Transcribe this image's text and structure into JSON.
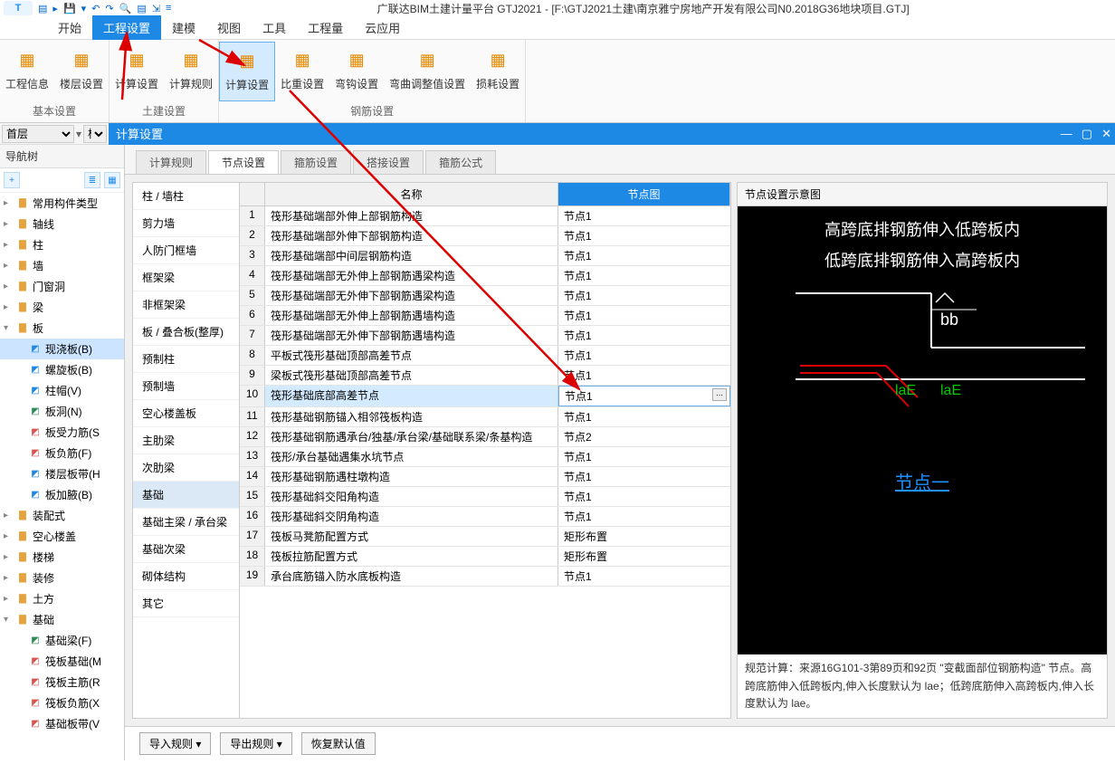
{
  "title": "广联达BIM土建计量平台 GTJ2021 - [F:\\GTJ2021土建\\南京雅宁房地产开发有限公司N0.2018G36地块项目.GTJ]",
  "logo": "T",
  "menubar": {
    "items": [
      "开始",
      "工程设置",
      "建模",
      "视图",
      "工具",
      "工程量",
      "云应用"
    ],
    "active": 1
  },
  "ribbon": {
    "groups": [
      {
        "label": "基本设置",
        "buttons": [
          {
            "label": "工程信息"
          },
          {
            "label": "楼层设置"
          }
        ]
      },
      {
        "label": "土建设置",
        "buttons": [
          {
            "label": "计算设置"
          },
          {
            "label": "计算规则"
          }
        ]
      },
      {
        "label": "钢筋设置",
        "buttons": [
          {
            "label": "计算设置",
            "active": true
          },
          {
            "label": "比重设置"
          },
          {
            "label": "弯钩设置"
          },
          {
            "label": "弯曲调整值设置"
          },
          {
            "label": "损耗设置"
          }
        ]
      }
    ]
  },
  "subbar": {
    "sel1": "首层",
    "sel2": "板",
    "calc_header": "计算设置"
  },
  "nav": {
    "title": "导航树",
    "tree": [
      {
        "label": "常用构件类型",
        "root": true
      },
      {
        "label": "轴线",
        "root": true
      },
      {
        "label": "柱",
        "root": true
      },
      {
        "label": "墙",
        "root": true
      },
      {
        "label": "门窗洞",
        "root": true
      },
      {
        "label": "梁",
        "root": true
      },
      {
        "label": "板",
        "root": true,
        "expanded": true,
        "children": [
          {
            "label": "现浇板(B)",
            "icon": "blue",
            "selected": true
          },
          {
            "label": "螺旋板(B)",
            "icon": "blue"
          },
          {
            "label": "柱帽(V)",
            "icon": "blue"
          },
          {
            "label": "板洞(N)",
            "icon": "green"
          },
          {
            "label": "板受力筋(S",
            "icon": "red"
          },
          {
            "label": "板负筋(F)",
            "icon": "red"
          },
          {
            "label": "楼层板带(H",
            "icon": "blue"
          },
          {
            "label": "板加腋(B)",
            "icon": "blue"
          }
        ]
      },
      {
        "label": "装配式",
        "root": true
      },
      {
        "label": "空心楼盖",
        "root": true
      },
      {
        "label": "楼梯",
        "root": true
      },
      {
        "label": "装修",
        "root": true
      },
      {
        "label": "土方",
        "root": true
      },
      {
        "label": "基础",
        "root": true,
        "expanded": true,
        "children": [
          {
            "label": "基础梁(F)",
            "icon": "green"
          },
          {
            "label": "筏板基础(M",
            "icon": "red"
          },
          {
            "label": "筏板主筋(R",
            "icon": "red"
          },
          {
            "label": "筏板负筋(X",
            "icon": "red"
          },
          {
            "label": "基础板带(V",
            "icon": "red"
          }
        ]
      }
    ]
  },
  "tabs": {
    "items": [
      "计算规则",
      "节点设置",
      "箍筋设置",
      "搭接设置",
      "箍筋公式"
    ],
    "active": 1
  },
  "categories": {
    "items": [
      "柱 / 墙柱",
      "剪力墙",
      "人防门框墙",
      "框架梁",
      "非框架梁",
      "板 / 叠合板(整厚)",
      "预制柱",
      "预制墙",
      "空心楼盖板",
      "主肋梁",
      "次肋梁",
      "基础",
      "基础主梁 / 承台梁",
      "基础次梁",
      "砌体结构",
      "其它"
    ],
    "active": 11
  },
  "table": {
    "head_name": "名称",
    "head_node": "节点图",
    "rows": [
      {
        "name": "筏形基础端部外伸上部钢筋构造",
        "node": "节点1"
      },
      {
        "name": "筏形基础端部外伸下部钢筋构造",
        "node": "节点1"
      },
      {
        "name": "筏形基础端部中间层钢筋构造",
        "node": "节点1"
      },
      {
        "name": "筏形基础端部无外伸上部钢筋遇梁构造",
        "node": "节点1"
      },
      {
        "name": "筏形基础端部无外伸下部钢筋遇梁构造",
        "node": "节点1"
      },
      {
        "name": "筏形基础端部无外伸上部钢筋遇墙构造",
        "node": "节点1"
      },
      {
        "name": "筏形基础端部无外伸下部钢筋遇墙构造",
        "node": "节点1"
      },
      {
        "name": "平板式筏形基础顶部高差节点",
        "node": "节点1"
      },
      {
        "name": "梁板式筏形基础顶部高差节点",
        "node": "节点1"
      },
      {
        "name": "筏形基础底部高差节点",
        "node": "节点1",
        "selected": true
      },
      {
        "name": "筏形基础钢筋锚入相邻筏板构造",
        "node": "节点1"
      },
      {
        "name": "筏形基础钢筋遇承台/独基/承台梁/基础联系梁/条基构造",
        "node": "节点2"
      },
      {
        "name": "筏形/承台基础遇集水坑节点",
        "node": "节点1"
      },
      {
        "name": "筏形基础钢筋遇柱墩构造",
        "node": "节点1"
      },
      {
        "name": "筏形基础斜交阳角构造",
        "node": "节点1"
      },
      {
        "name": "筏形基础斜交阴角构造",
        "node": "节点1"
      },
      {
        "name": "筏板马凳筋配置方式",
        "node": "矩形布置"
      },
      {
        "name": "筏板拉筋配置方式",
        "node": "矩形布置"
      },
      {
        "name": "承台底筋锚入防水底板构造",
        "node": "节点1"
      }
    ]
  },
  "diagram": {
    "title": "节点设置示意图",
    "line1": "高跨底排钢筋伸入低跨板内",
    "line2": "低跨底排钢筋伸入高跨板内",
    "lbl_bb": "bb",
    "lbl_lae1": "laE",
    "lbl_lae2": "laE",
    "link": "节点一",
    "note": "规范计算：来源16G101-3第89页和92页 \"变截面部位钢筋构造\" 节点。高跨底筋伸入低跨板内,伸入长度默认为 lae；低跨底筋伸入高跨板内,伸入长度默认为 lae。"
  },
  "bottom": {
    "btn1": "导入规则 ▾",
    "btn2": "导出规则 ▾",
    "btn3": "恢复默认值"
  }
}
